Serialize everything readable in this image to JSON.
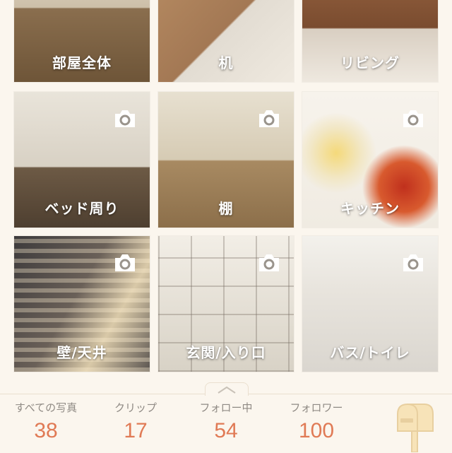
{
  "categories": [
    {
      "label": "部屋全体",
      "camera": false
    },
    {
      "label": "机",
      "camera": false
    },
    {
      "label": "リビング",
      "camera": false
    },
    {
      "label": "ベッド周り",
      "camera": true
    },
    {
      "label": "棚",
      "camera": true
    },
    {
      "label": "キッチン",
      "camera": true
    },
    {
      "label": "壁/天井",
      "camera": true
    },
    {
      "label": "玄関/入り口",
      "camera": true
    },
    {
      "label": "バス/トイレ",
      "camera": true
    }
  ],
  "stats": [
    {
      "label": "すべての写真",
      "value": "38"
    },
    {
      "label": "クリップ",
      "value": "17"
    },
    {
      "label": "フォロー中",
      "value": "54"
    },
    {
      "label": "フォロワー",
      "value": "100"
    }
  ],
  "colors": {
    "accent": "#e07a55",
    "stat_label": "#8f8a84",
    "background": "#fbf6ee"
  },
  "icons": [
    "camera-icon",
    "chevron-up-icon",
    "mailbox-icon"
  ]
}
